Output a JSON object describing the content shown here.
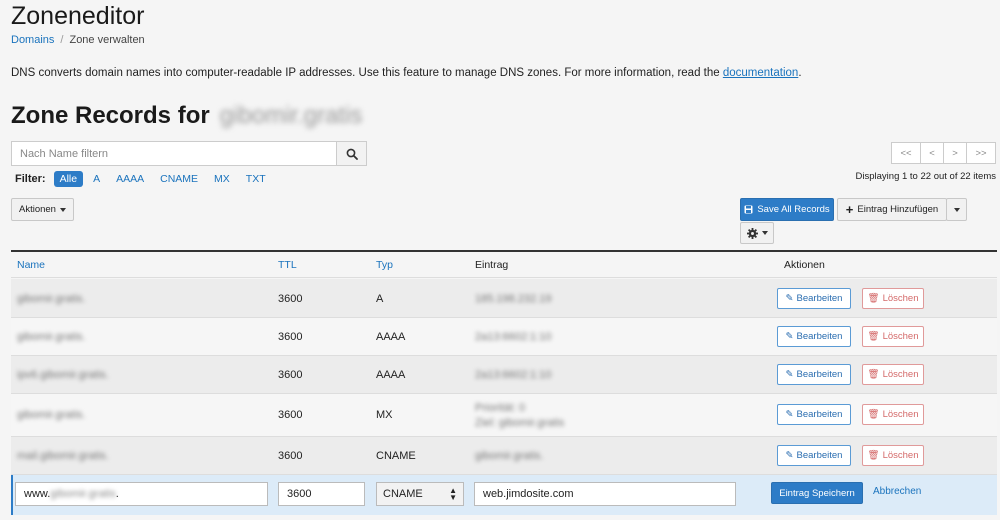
{
  "header": {
    "title": "Zoneneditor",
    "breadcrumb": {
      "root": "Domains",
      "sep": "/",
      "current": "Zone verwalten"
    }
  },
  "intro": {
    "text": "DNS converts domain names into computer-readable IP addresses. Use this feature to manage DNS zones. For more information, read the ",
    "link": "documentation",
    "end": "."
  },
  "section": {
    "title": "Zone Records for",
    "domain_blurred": "gibomir.gratis"
  },
  "search": {
    "placeholder": "Nach Name filtern"
  },
  "filter": {
    "label": "Filter:",
    "options": [
      "Alle",
      "A",
      "AAAA",
      "CNAME",
      "MX",
      "TXT"
    ],
    "active": "Alle"
  },
  "pagination": {
    "buttons": [
      "<<",
      "<",
      ">",
      ">>"
    ],
    "info": "Displaying 1 to 22 out of 22 items"
  },
  "toolbar": {
    "actions": "Aktionen",
    "save_all": "Save All Records",
    "add": "Eintrag Hinzufügen"
  },
  "table": {
    "headers": {
      "name": "Name",
      "ttl": "TTL",
      "type": "Typ",
      "record": "Eintrag",
      "actions": "Aktionen"
    },
    "edit_label": "Bearbeiten",
    "delete_label": "Löschen",
    "rows": [
      {
        "name": "gibomir.gratis.",
        "ttl": "3600",
        "type": "A",
        "record": "185.198.232.19",
        "record2": ""
      },
      {
        "name": "gibomir.gratis.",
        "ttl": "3600",
        "type": "AAAA",
        "record": "2a13:6602:1:10",
        "record2": ""
      },
      {
        "name": "ipv6.gibomir.gratis.",
        "ttl": "3600",
        "type": "AAAA",
        "record": "2a13:6602:1:10",
        "record2": ""
      },
      {
        "name": "gibomir.gratis.",
        "ttl": "3600",
        "type": "MX",
        "record": "Priorität: 0",
        "record2": "Ziel: gibomir.gratis"
      },
      {
        "name": "mail.gibomir.gratis.",
        "ttl": "3600",
        "type": "CNAME",
        "record": "gibomir.gratis.",
        "record2": ""
      }
    ]
  },
  "edit_row": {
    "name_prefix": "www.",
    "name_blurred": "gibomir.gratis",
    "name_suffix": ".",
    "ttl": "3600",
    "type": "CNAME",
    "record": "web.jimdosite.com",
    "save": "Eintrag Speichern",
    "cancel": "Abbrechen"
  },
  "colors": {
    "primary": "#2d7cc7",
    "link": "#1a73bd",
    "danger": "#d46a6a",
    "edit_bg": "#dcebf8"
  }
}
